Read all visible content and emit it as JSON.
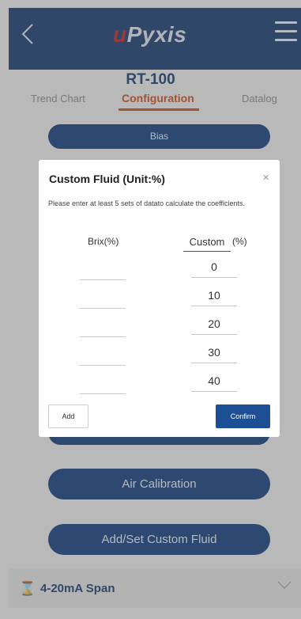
{
  "header": {
    "logo_u": "u",
    "logo_rest": "Pyxis"
  },
  "device": "RT-100",
  "tabs": [
    {
      "label": "Trend Chart",
      "active": false
    },
    {
      "label": "Configuration",
      "active": true
    },
    {
      "label": "Datalog",
      "active": false
    }
  ],
  "buttons": {
    "bias": "Bias",
    "air_calibration": "Air Calibration",
    "custom_fluid": "Add/Set Custom Fluid"
  },
  "section": {
    "label": "4-20mA Span"
  },
  "modal": {
    "title": "Custom Fluid (Unit:%)",
    "close": "×",
    "description": "Please enter at least 5 sets of datato calculate the coefficients.",
    "col_brix": "Brix(%)",
    "col_custom": "Custom",
    "col_unit": "(%)",
    "rows": [
      {
        "brix": "",
        "custom": "0"
      },
      {
        "brix": "",
        "custom": "10"
      },
      {
        "brix": "",
        "custom": "20"
      },
      {
        "brix": "",
        "custom": "30"
      },
      {
        "brix": "",
        "custom": "40"
      }
    ],
    "add": "Add",
    "confirm": "Confirm"
  },
  "colors": {
    "primary": "#1c3e72",
    "accent": "#c65323",
    "button": "#16407e"
  }
}
